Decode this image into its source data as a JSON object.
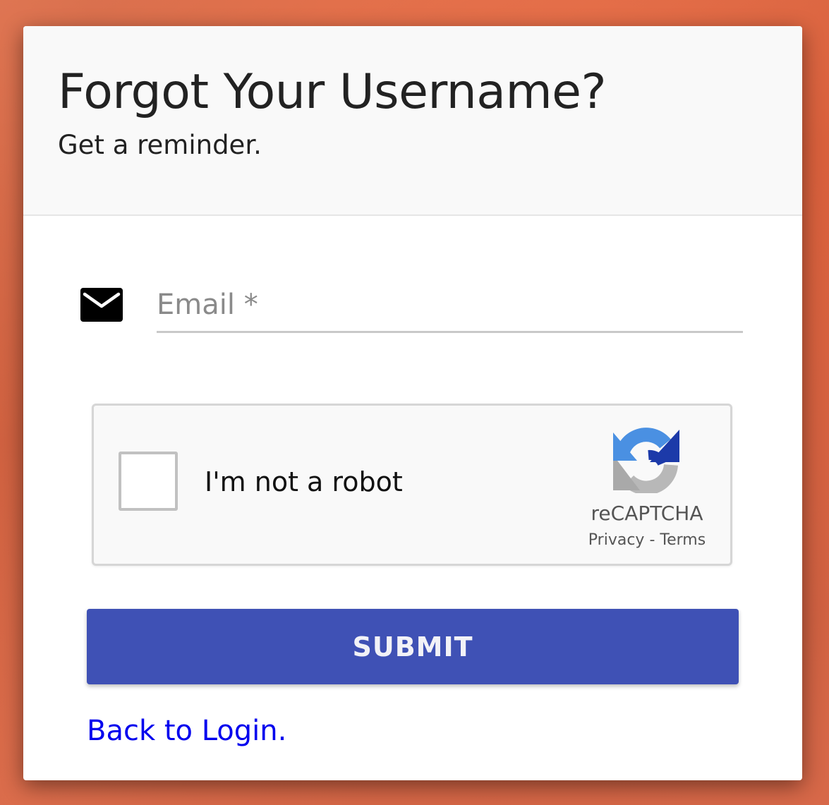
{
  "header": {
    "title": "Forgot Your Username?",
    "subtitle": "Get a reminder."
  },
  "form": {
    "email_icon": "email-envelope-icon",
    "email_placeholder": "Email *",
    "email_value": ""
  },
  "recaptcha": {
    "checkbox_label": "I'm not a robot",
    "brand": "reCAPTCHA",
    "privacy_label": "Privacy",
    "separator": "-",
    "terms_label": "Terms",
    "logo_icon": "recaptcha-logo-icon"
  },
  "actions": {
    "submit_label": "SUBMIT",
    "back_link_label": "Back to Login."
  },
  "colors": {
    "primary": "#3f51b5",
    "link": "#0000ee",
    "background": "#d9603c"
  }
}
